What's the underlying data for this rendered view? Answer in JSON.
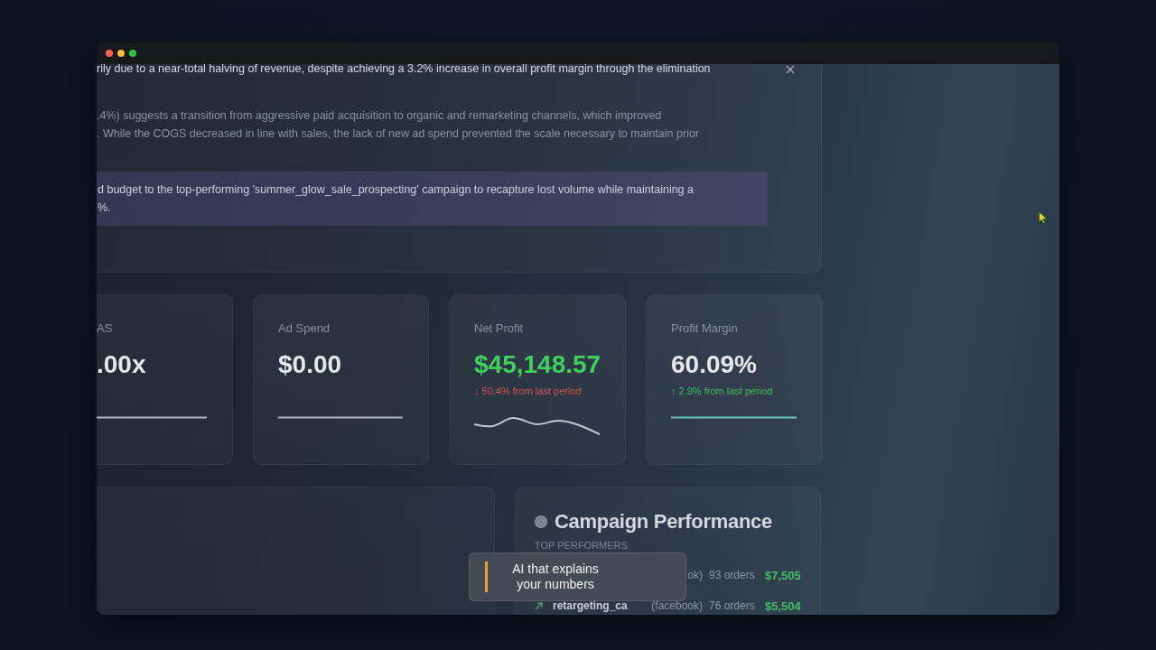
{
  "insight_panel": {
    "paragraphs": [
      {
        "kind": "summary",
        "lines": [
          "rily due to a near-total halving of revenue, despite achieving a 3.2% increase in overall profit margin through the elimination"
        ]
      },
      {
        "kind": "analysis",
        "lines": [
          ".4%) suggests a transition from aggressive paid acquisition to organic and remarketing channels, which improved",
          ". While the COGS decreased in line with sales, the lack of new ad spend prevented the scale necessary to maintain prior"
        ]
      },
      {
        "kind": "recommendation",
        "lines": [
          "d budget to the top-performing 'summer_glow_sale_prospecting' campaign to recapture lost volume while maintaining a",
          "%."
        ]
      }
    ]
  },
  "metrics": [
    {
      "label": "AS",
      "value": ".00x",
      "highlighted": false,
      "sparkline": {
        "kind": "flat",
        "color": "#aeb5c0"
      }
    },
    {
      "label": "Ad Spend",
      "value": "$0.00",
      "highlighted": false,
      "sparkline": {
        "kind": "flat",
        "color": "#aeb5c0"
      }
    },
    {
      "label": "Net Profit",
      "value": "$45,148.57",
      "highlighted": true,
      "change": {
        "text": "↓ 50.4% from last period",
        "rising": false
      },
      "sparkline": {
        "kind": "wave",
        "color": "#c3c9d4"
      }
    },
    {
      "label": "Profit Margin",
      "value": "60.09%",
      "highlighted": false,
      "change": {
        "text": "↑ 2.9% from last period",
        "rising": true
      },
      "sparkline": {
        "kind": "flat",
        "color": "#6fc2b6"
      }
    }
  ],
  "campaign_performance": {
    "title": "Campaign Performance",
    "subtitle": "TOP PERFORMERS",
    "rows": [
      {
        "platform": "ok)",
        "orders": "93 orders",
        "revenue": "$7,505"
      },
      {
        "name": "retargeting_ca",
        "platform": "(facebook)",
        "orders": "76 orders",
        "revenue": "$5,504"
      }
    ]
  },
  "caption": {
    "text": "AI that explains your numbers"
  }
}
